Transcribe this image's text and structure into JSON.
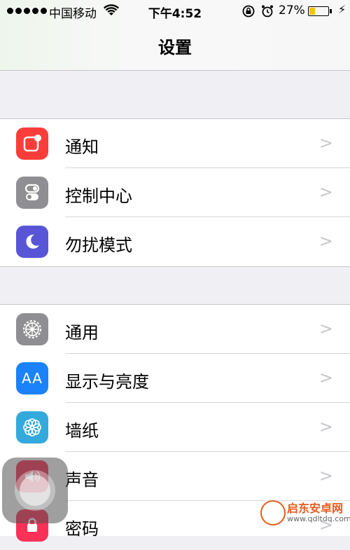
{
  "status": {
    "carrier": "中国移动",
    "time": "下午4:52",
    "battery_percent": "27%",
    "battery_level": 0.27
  },
  "nav": {
    "title": "设置"
  },
  "groups": [
    {
      "items": [
        {
          "label": "通知",
          "icon": "notifications-icon",
          "color": "#fc3d39"
        },
        {
          "label": "控制中心",
          "icon": "control-center-icon",
          "color": "#8e8e93"
        },
        {
          "label": "勿扰模式",
          "icon": "moon-icon",
          "color": "#5856d6"
        }
      ]
    },
    {
      "items": [
        {
          "label": "通用",
          "icon": "gear-icon",
          "color": "#8e8e93"
        },
        {
          "label": "显示与亮度",
          "icon": "display-brightness-icon",
          "color": "#1a82fb"
        },
        {
          "label": "墙纸",
          "icon": "wallpaper-icon",
          "color": "#34aadc"
        },
        {
          "label": "声音",
          "icon": "speaker-icon",
          "color": "#fc3158"
        },
        {
          "label": "密码",
          "icon": "lock-icon",
          "color": "#fc3158"
        }
      ]
    }
  ],
  "icons": {
    "display_text": "AA"
  },
  "watermark": {
    "title": "启东安卓网",
    "url": "www.qdltdq.com"
  }
}
